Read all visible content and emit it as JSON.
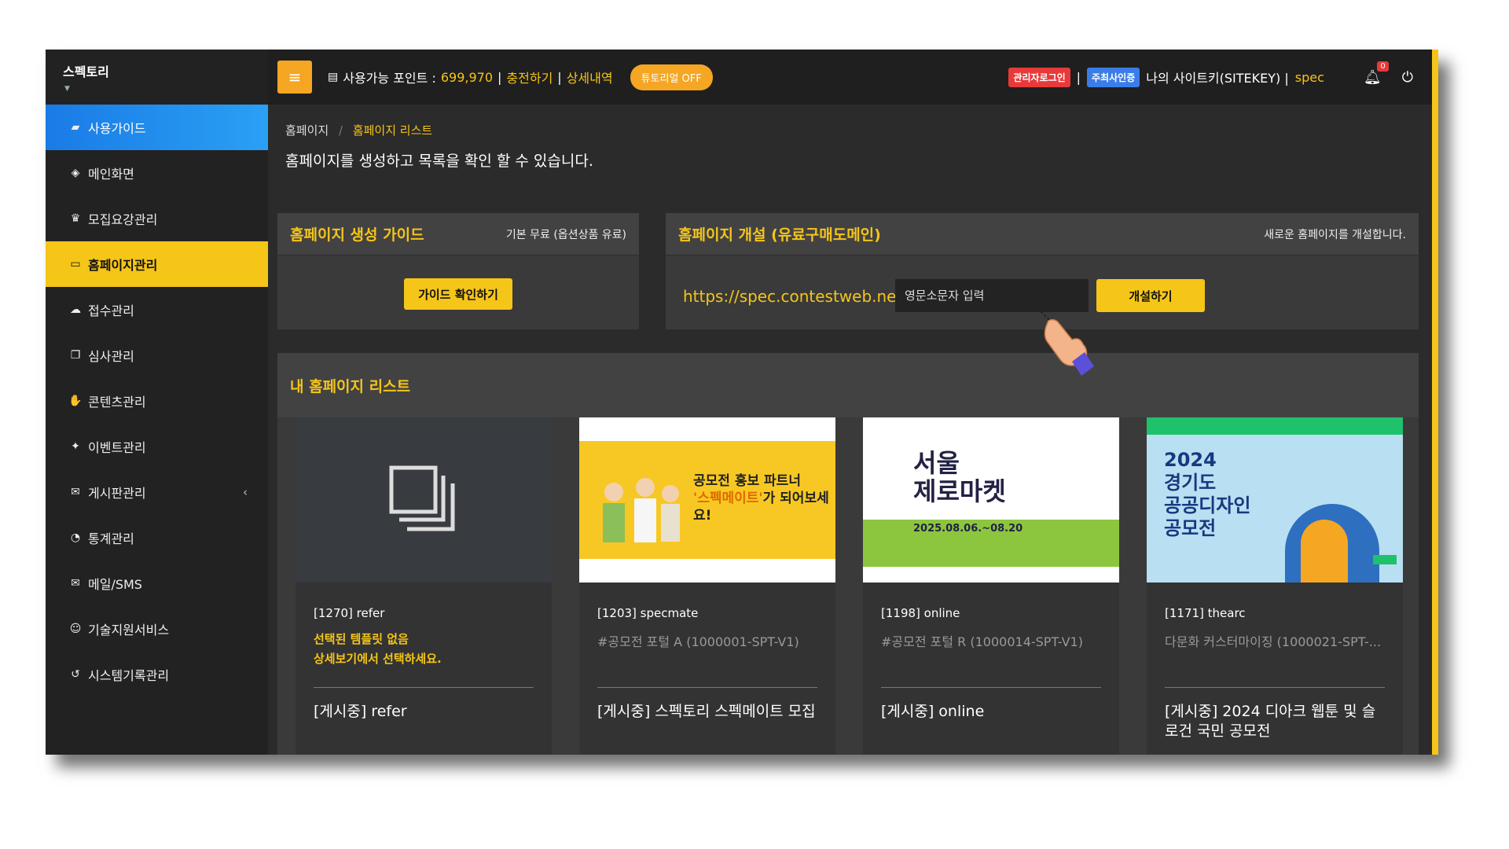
{
  "brand": "스펙토리",
  "sidebar": {
    "items": [
      {
        "label": "사용가이드",
        "icon": "book-icon"
      },
      {
        "label": "메인화면",
        "icon": "cube-icon"
      },
      {
        "label": "모집요강관리",
        "icon": "trophy-icon"
      },
      {
        "label": "홈페이지관리",
        "icon": "monitor-icon"
      },
      {
        "label": "접수관리",
        "icon": "cloud-upload-icon"
      },
      {
        "label": "심사관리",
        "icon": "copy-icon"
      },
      {
        "label": "콘텐츠관리",
        "icon": "thumbs-up-icon"
      },
      {
        "label": "이벤트관리",
        "icon": "gift-icon"
      },
      {
        "label": "게시판관리",
        "icon": "comments-icon"
      },
      {
        "label": "통계관리",
        "icon": "pie-chart-icon"
      },
      {
        "label": "메일/SMS",
        "icon": "envelope-icon"
      },
      {
        "label": "기술지원서비스",
        "icon": "smile-icon"
      },
      {
        "label": "시스템기록관리",
        "icon": "history-icon"
      }
    ]
  },
  "topbar": {
    "points_label": "사용가능 포인트 :",
    "points_value": "699,970",
    "sep": "|",
    "charge_link": "충전하기",
    "detail_link": "상세내역",
    "tutorial_toggle": "튜토리얼 OFF",
    "admin_login_badge": "관리자로그인",
    "host_auth_badge": "주최사인증",
    "sitekey_label": "나의 사이트키(SITEKEY) |",
    "sitekey_value": "spec",
    "notification_count": "0"
  },
  "breadcrumb": {
    "home": "홈페이지",
    "separator": "/",
    "current": "홈페이지 리스트"
  },
  "page_description": "홈페이지를 생성하고 목록을 확인 할 수 있습니다.",
  "guide_panel": {
    "title": "홈페이지 생성 가이드",
    "note": "기본 무료 (옵션상품 유료)",
    "button": "가이드 확인하기"
  },
  "create_panel": {
    "title": "홈페이지 개설 (유료구매도메인)",
    "note": "새로운 홈페이지를 개설합니다.",
    "url_prefix": "https://spec.contestweb.net/",
    "input_placeholder": "영문소문자 입력",
    "button": "개설하기"
  },
  "list_panel": {
    "title": "내 홈페이지 리스트"
  },
  "cards": [
    {
      "id_text": "[1270] refer",
      "warn1": "선택된 템플릿 없음",
      "warn2": "상세보기에서 선택하세요.",
      "title": "[게시중] refer"
    },
    {
      "id_text": "[1203] specmate",
      "subtitle": "#공모전 포털 A (1000001-SPT-V1)",
      "title": "[게시중] 스펙토리 스펙메이트 모집",
      "thumb_line1": "공모전 홍보 파트너",
      "thumb_line2a": "'스펙메이트'",
      "thumb_line2b": "가 되어보세요!"
    },
    {
      "id_text": "[1198] online",
      "subtitle": "#공모전 포털 R (1000014-SPT-V1)",
      "title": "[게시중] online",
      "thumb_line1": "서울",
      "thumb_line2": "제로마켓",
      "thumb_date": "2025.08.06.~08.20"
    },
    {
      "id_text": "[1171] thearc",
      "subtitle": "다문화 커스터마이징 (1000021-SPT-...",
      "title": "[게시중] 2024 디아크 웹툰 및 슬로건 국민 공모전",
      "thumb_line1": "2024",
      "thumb_line2": "경기도",
      "thumb_line3": "공공디자인",
      "thumb_line4": "공모전"
    }
  ],
  "colors": {
    "accent_yellow": "#f5c518",
    "accent_orange": "#f5a623",
    "active_blue": "#1a7be6",
    "background": "#2b2b2b"
  }
}
